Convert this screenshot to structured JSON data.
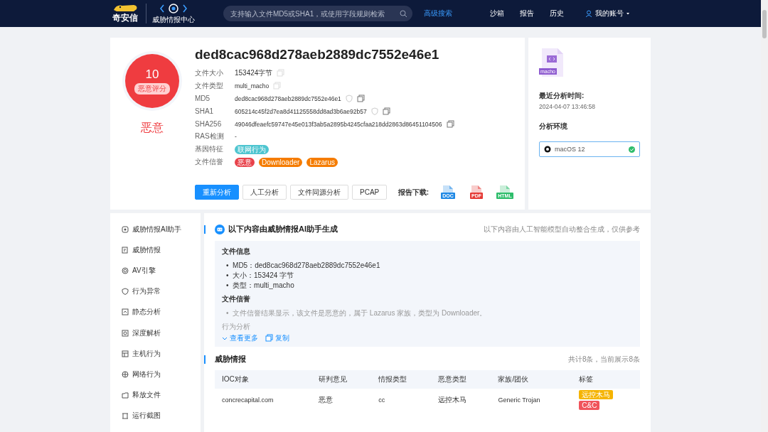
{
  "header": {
    "brand": "奇安信",
    "product": "威胁情报中心",
    "search": {
      "placeholder": "支持输入文件MD5或SHA1，或使用字段规则检索"
    },
    "advanced_search": "高级搜索",
    "nav": [
      "沙箱",
      "报告",
      "历史"
    ],
    "account": "我的账号"
  },
  "summary": {
    "score": "10",
    "score_label": "恶意评分",
    "verdict": "恶意",
    "title": "ded8cac968d278aeb2889dc7552e46e1",
    "fields": [
      {
        "label": "文件大小",
        "kind": "copy",
        "value": "153424字节"
      },
      {
        "label": "文件类型",
        "kind": "copy",
        "value": "multi_macho"
      },
      {
        "label": "MD5",
        "kind": "hash",
        "value": "ded8cac968d278aeb2889dc7552e46e1"
      },
      {
        "label": "SHA1",
        "kind": "hash",
        "value": "605214c45f2d7ea8d41125558dd8ad3b6ae92b57"
      },
      {
        "label": "SHA256",
        "kind": "sha",
        "value": "49046dfeaefc59747e45e013f3ab5a2895b4245cfaa218dd2863d86451104506"
      },
      {
        "label": "RAS检测",
        "kind": "plain",
        "value": "-"
      },
      {
        "label": "基因特征",
        "kind": "tags",
        "tags": [
          {
            "text": "联网行为",
            "color": "#4ec5d0"
          }
        ]
      },
      {
        "label": "文件信誉",
        "kind": "tags",
        "tags": [
          {
            "text": "恶意",
            "color": "#e8414a"
          },
          {
            "text": "Downloader",
            "color": "#f57c00"
          },
          {
            "text": "Lazarus",
            "color": "#f57c00"
          }
        ]
      }
    ],
    "buttons": [
      {
        "label": "重新分析",
        "primary": true
      },
      {
        "label": "人工分析",
        "primary": false
      },
      {
        "label": "文件同源分析",
        "primary": false
      },
      {
        "label": "PCAP",
        "primary": false
      }
    ],
    "download_label": "报告下载:",
    "downloads": [
      {
        "format": "DOC",
        "color": "#1e88e5"
      },
      {
        "format": "PDF",
        "color": "#e53935"
      },
      {
        "format": "HTML",
        "color": "#2ebd6b"
      }
    ]
  },
  "side": {
    "file_badge": "macho",
    "last_time_label": "最近分析时间:",
    "last_time": "2024-04-07 13:46:58",
    "env_label": "分析环境",
    "env": {
      "name": "macOS 12",
      "done": true
    }
  },
  "sidebar": {
    "items": [
      {
        "label": "威胁情报AI助手",
        "selected": false
      },
      {
        "label": "威胁情报",
        "selected": false
      },
      {
        "label": "AV引擎",
        "selected": false
      },
      {
        "label": "行为异常",
        "selected": false
      },
      {
        "label": "静态分析",
        "selected": false
      },
      {
        "label": "深度解析",
        "selected": false
      },
      {
        "label": "主机行为",
        "selected": false
      },
      {
        "label": "网络行为",
        "selected": false
      },
      {
        "label": "释放文件",
        "selected": false
      },
      {
        "label": "运行截图",
        "selected": false
      }
    ]
  },
  "ai": {
    "title": "以下内容由威胁情报AI助手生成",
    "note": "以下内容由人工智能模型自动整合生成，仅供参考",
    "sections": [
      {
        "heading": "文件信息",
        "faded": false,
        "items": [
          "MD5：ded8cac968d278aeb2889dc7552e46e1",
          "大小：153424 字节",
          "类型：multi_macho"
        ]
      },
      {
        "heading": "文件信誉",
        "faded": true,
        "items": [
          "文件信誉结果显示，该文件是恶意的，属于 Lazarus 家族，类型为 Downloader。"
        ]
      }
    ],
    "bullet": "•",
    "fade_heading": "行为分析",
    "more": "查看更多",
    "copy": "复制"
  },
  "intel": {
    "title": "威胁情报",
    "count": "共计8条，当前展示8条",
    "columns": [
      "IOC对象",
      "研判意见",
      "情报类型",
      "恶意类型",
      "家族/团伙",
      "标签"
    ],
    "rows": [
      {
        "ioc": "concrecapital.com",
        "verdict": "恶意",
        "type": "cc",
        "malware": "远控木马",
        "family": "Generic Trojan",
        "tags": [
          {
            "text": "远控木马",
            "color": "#f5b400"
          },
          {
            "text": "C&C",
            "color": "#f0545c"
          }
        ]
      }
    ]
  }
}
